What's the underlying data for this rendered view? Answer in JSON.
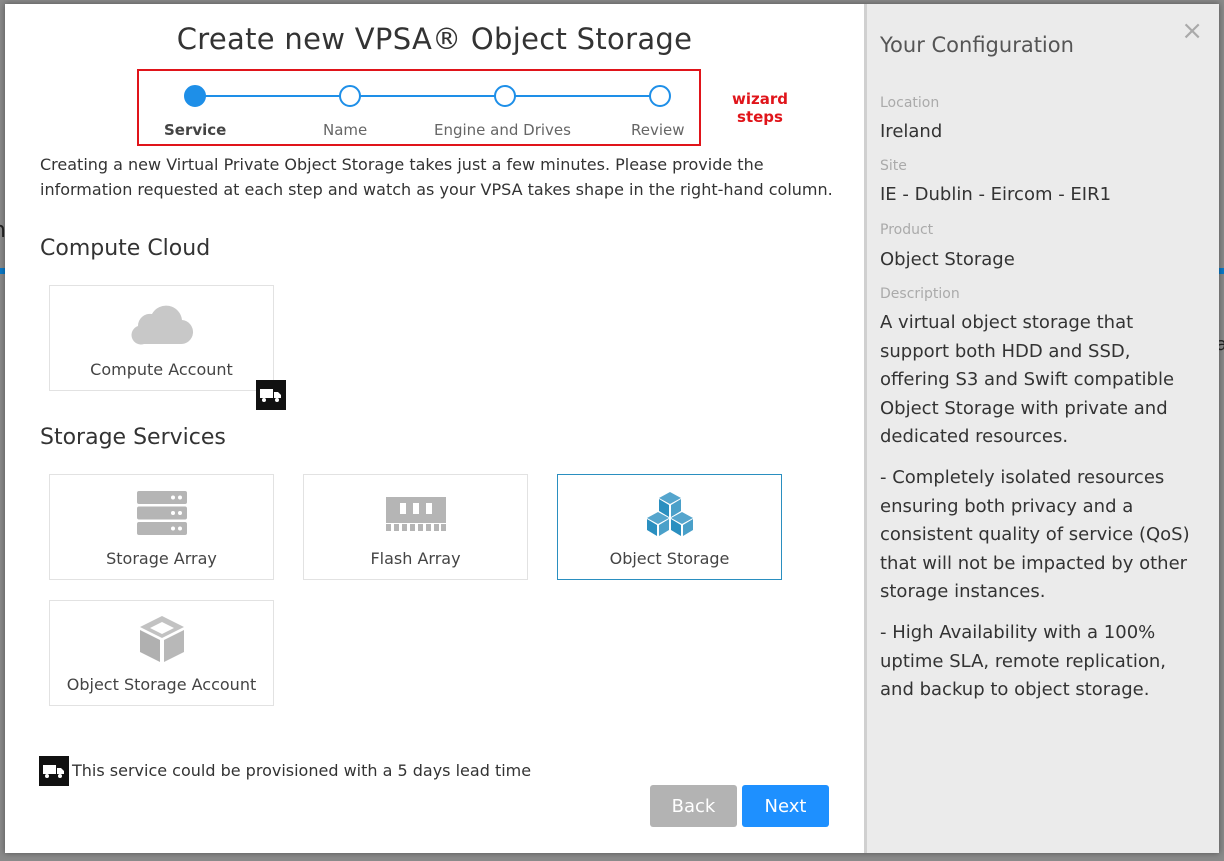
{
  "modal": {
    "title": "Create new VPSA® Object Storage",
    "close_symbol": "×"
  },
  "wizard": {
    "steps": [
      {
        "label": "Service",
        "state": "active"
      },
      {
        "label": "Name",
        "state": "pending"
      },
      {
        "label": "Engine and Drives",
        "state": "pending"
      },
      {
        "label": "Review",
        "state": "pending"
      }
    ],
    "annotation_line1": "wizard",
    "annotation_line2": "steps",
    "accent_color": "#1e8fe8",
    "annotation_color": "#e0141a"
  },
  "intro_text": "Creating a new Virtual Private Object Storage takes just a few minutes. Please provide the information requested at each step and watch as your VPSA takes shape in the right-hand column.",
  "sections": {
    "compute": {
      "title": "Compute Cloud",
      "cards": [
        {
          "label": "Compute Account",
          "icon": "cloud-icon",
          "lead_time_badge": "truck-icon"
        }
      ]
    },
    "storage": {
      "title": "Storage Services",
      "cards": [
        {
          "label": "Storage Array",
          "icon": "server-rack-icon"
        },
        {
          "label": "Flash Array",
          "icon": "memory-module-icon"
        },
        {
          "label": "Object Storage",
          "icon": "cubes-icon",
          "selected": true
        },
        {
          "label": "Object Storage Account",
          "icon": "cube-icon"
        }
      ]
    }
  },
  "lead_time_note": "This service could be provisioned with a 5 days lead time",
  "buttons": {
    "back": "Back",
    "next": "Next"
  },
  "configuration": {
    "title": "Your Configuration",
    "location_label": "Location",
    "location_value": "Ireland",
    "site_label": "Site",
    "site_value": "IE - Dublin - Eircom - EIR1",
    "product_label": "Product",
    "product_value": "Object Storage",
    "description_label": "Description",
    "description_p1": "A virtual object storage that support both HDD and SSD, offering S3 and Swift compatible Object Storage with private and dedicated resources.",
    "description_p2": "- Completely isolated resources ensuring both privacy and a consistent quality of service (QoS) that will not be impacted by other storage instances.",
    "description_p3": "- High Availability with a 100% uptime SLA, remote replication, and backup to object storage."
  },
  "background": {
    "left_letter": "n",
    "right_letter": "a"
  }
}
